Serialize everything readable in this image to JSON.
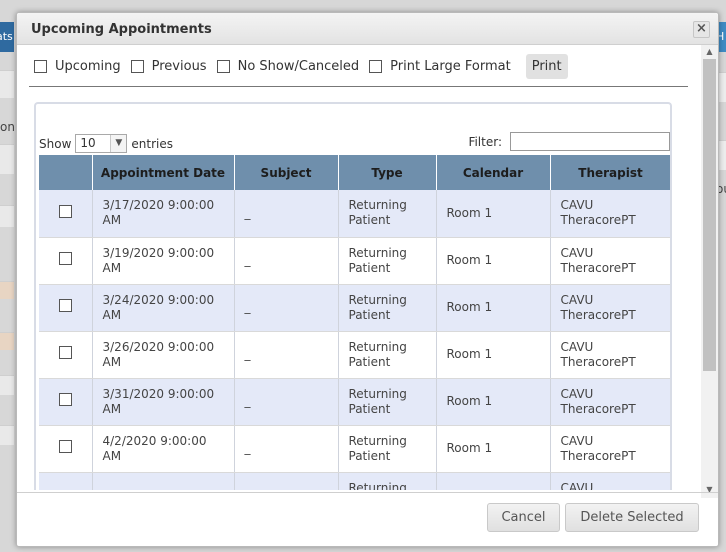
{
  "background": {
    "left_tab_text": "ats",
    "left_text": "on",
    "right_tab_text": "H",
    "right_text": "ou"
  },
  "dialog": {
    "title": "Upcoming Appointments",
    "close_glyph": "×"
  },
  "options": [
    {
      "label": "Upcoming"
    },
    {
      "label": "Previous"
    },
    {
      "label": "No Show/Canceled"
    },
    {
      "label": "Print Large Format"
    }
  ],
  "print_label": "Print",
  "table_controls": {
    "show_label": "Show",
    "entries_value": "10",
    "entries_label": "entries",
    "filter_label": "Filter:"
  },
  "table": {
    "columns": [
      "",
      "Appointment Date",
      "Subject",
      "Type",
      "Calendar",
      "Therapist"
    ],
    "rows": [
      {
        "date": "3/17/2020 9:00:00 AM",
        "subject": "_",
        "type": "Returning Patient",
        "calendar": "Room 1",
        "therapist": "CAVU TheracorePT"
      },
      {
        "date": "3/19/2020 9:00:00 AM",
        "subject": "_",
        "type": "Returning Patient",
        "calendar": "Room 1",
        "therapist": "CAVU TheracorePT"
      },
      {
        "date": "3/24/2020 9:00:00 AM",
        "subject": "_",
        "type": "Returning Patient",
        "calendar": "Room 1",
        "therapist": "CAVU TheracorePT"
      },
      {
        "date": "3/26/2020 9:00:00 AM",
        "subject": "_",
        "type": "Returning Patient",
        "calendar": "Room 1",
        "therapist": "CAVU TheracorePT"
      },
      {
        "date": "3/31/2020 9:00:00 AM",
        "subject": "_",
        "type": "Returning Patient",
        "calendar": "Room 1",
        "therapist": "CAVU TheracorePT"
      },
      {
        "date": "4/2/2020 9:00:00 AM",
        "subject": "_",
        "type": "Returning Patient",
        "calendar": "Room 1",
        "therapist": "CAVU TheracorePT"
      },
      {
        "date": "",
        "subject": "",
        "type": "Returning Patient",
        "calendar": "",
        "therapist": "CAVU TheracorePT"
      }
    ]
  },
  "footer": {
    "cancel_label": "Cancel",
    "delete_label": "Delete Selected"
  },
  "colors": {
    "header_bg": "#6f8fac",
    "row_alt": "#e4e9f8",
    "titlebar": "#e3e3e3"
  }
}
